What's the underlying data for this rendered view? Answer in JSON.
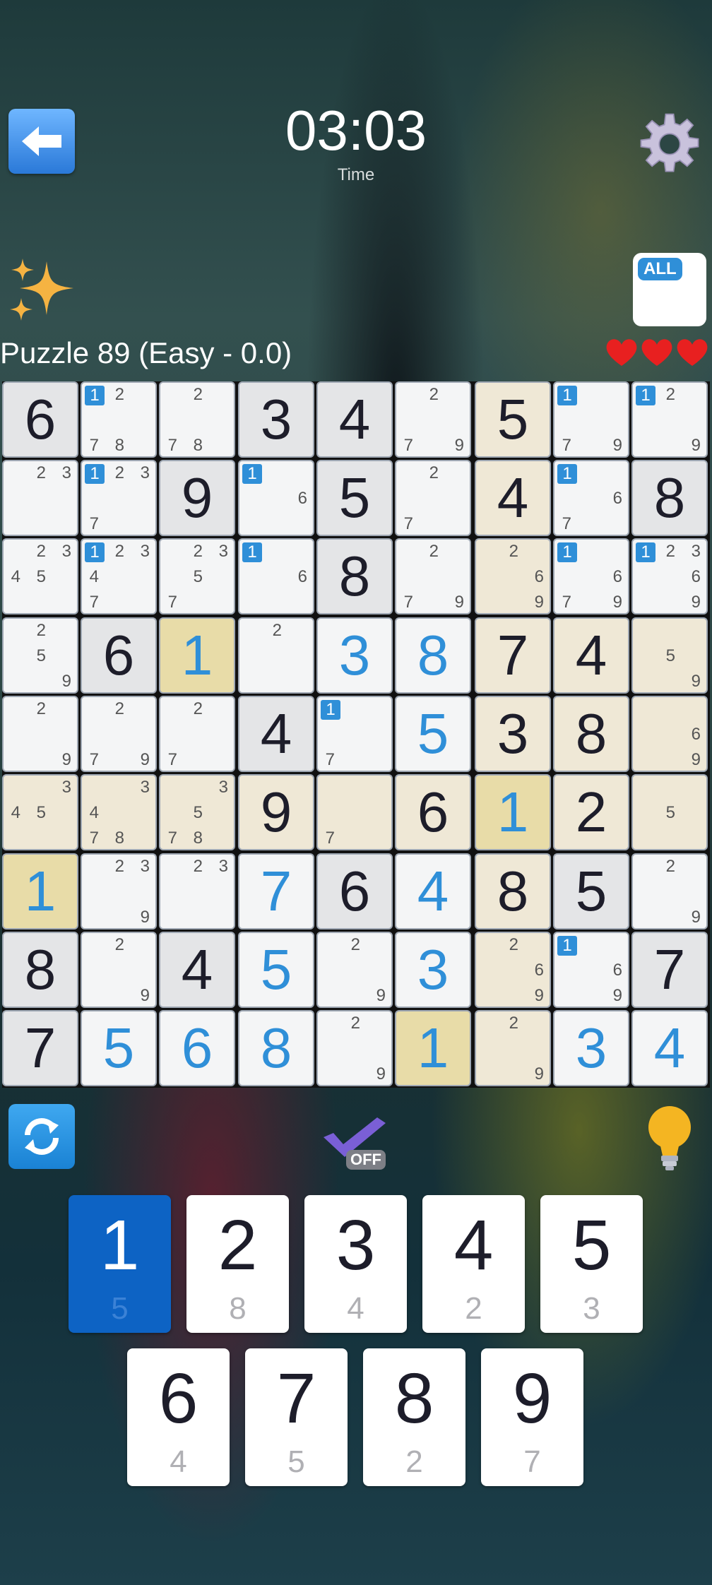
{
  "header": {
    "timer": "03:03",
    "timer_label": "Time"
  },
  "puzzle": {
    "title": "Puzzle 89 (Easy - 0.0)",
    "lives": 3
  },
  "all_button": {
    "badge": "ALL"
  },
  "auto_check": {
    "state_label": "OFF"
  },
  "colors": {
    "accent": "#2f8fd8",
    "selected_key": "#0d63c4",
    "given_text": "#1d1d2a",
    "user_text": "#2f8fd8",
    "heart": "#e82020"
  },
  "board": [
    [
      {
        "v": 6,
        "g": true,
        "c": "given"
      },
      {
        "n": [
          1,
          2,
          7,
          8
        ],
        "h": [
          1
        ],
        "c": "white"
      },
      {
        "n": [
          2,
          7,
          8
        ],
        "c": "white"
      },
      {
        "v": 3,
        "g": true,
        "c": "given"
      },
      {
        "v": 4,
        "g": true,
        "c": "given"
      },
      {
        "n": [
          2,
          7,
          9
        ],
        "c": "white"
      },
      {
        "v": 5,
        "g": true,
        "c": "peach"
      },
      {
        "n": [
          1,
          7,
          9
        ],
        "h": [
          1
        ],
        "c": "white"
      },
      {
        "n": [
          1,
          2,
          9
        ],
        "h": [
          1
        ],
        "c": "white"
      }
    ],
    [
      {
        "n": [
          2,
          3
        ],
        "c": "white"
      },
      {
        "n": [
          1,
          2,
          3,
          7
        ],
        "h": [
          1
        ],
        "c": "white"
      },
      {
        "v": 9,
        "g": true,
        "c": "given"
      },
      {
        "n": [
          1,
          6
        ],
        "h": [
          1
        ],
        "c": "white"
      },
      {
        "v": 5,
        "g": true,
        "c": "given"
      },
      {
        "n": [
          2,
          7
        ],
        "c": "white"
      },
      {
        "v": 4,
        "g": true,
        "c": "peach"
      },
      {
        "n": [
          1,
          6,
          7
        ],
        "h": [
          1
        ],
        "c": "white"
      },
      {
        "v": 8,
        "g": true,
        "c": "given"
      }
    ],
    [
      {
        "n": [
          2,
          3,
          4,
          5
        ],
        "c": "white"
      },
      {
        "n": [
          1,
          2,
          3,
          4,
          7
        ],
        "h": [
          1
        ],
        "c": "white"
      },
      {
        "n": [
          2,
          3,
          5,
          7
        ],
        "c": "white"
      },
      {
        "n": [
          1,
          6
        ],
        "h": [
          1
        ],
        "c": "white"
      },
      {
        "v": 8,
        "g": true,
        "c": "given"
      },
      {
        "n": [
          2,
          7,
          9
        ],
        "c": "white"
      },
      {
        "n": [
          2,
          6,
          9
        ],
        "c": "peach"
      },
      {
        "n": [
          1,
          6,
          7,
          9
        ],
        "h": [
          1
        ],
        "c": "white"
      },
      {
        "n": [
          1,
          2,
          3,
          6,
          9
        ],
        "h": [
          1
        ],
        "c": "white"
      }
    ],
    [
      {
        "n": [
          2,
          5,
          9
        ],
        "c": "white"
      },
      {
        "v": 6,
        "g": true,
        "c": "given"
      },
      {
        "v": 1,
        "g": false,
        "c": "sel"
      },
      {
        "n": [
          2
        ],
        "c": "white"
      },
      {
        "v": 3,
        "g": false,
        "c": "white"
      },
      {
        "v": 8,
        "g": false,
        "c": "white"
      },
      {
        "v": 7,
        "g": true,
        "c": "peach"
      },
      {
        "v": 4,
        "g": true,
        "c": "peach"
      },
      {
        "n": [
          5,
          9
        ],
        "c": "peach"
      }
    ],
    [
      {
        "n": [
          2,
          9
        ],
        "c": "white"
      },
      {
        "n": [
          2,
          7,
          9
        ],
        "c": "white"
      },
      {
        "n": [
          2,
          7
        ],
        "c": "white"
      },
      {
        "v": 4,
        "g": true,
        "c": "given"
      },
      {
        "n": [
          1,
          7
        ],
        "h": [
          1
        ],
        "c": "white"
      },
      {
        "v": 5,
        "g": false,
        "c": "white"
      },
      {
        "v": 3,
        "g": true,
        "c": "peach"
      },
      {
        "v": 8,
        "g": true,
        "c": "peach"
      },
      {
        "n": [
          6,
          9
        ],
        "c": "peach"
      }
    ],
    [
      {
        "n": [
          3,
          4,
          5
        ],
        "c": "peach"
      },
      {
        "n": [
          3,
          4,
          7,
          8
        ],
        "c": "peach"
      },
      {
        "n": [
          3,
          5,
          7,
          8
        ],
        "c": "peach"
      },
      {
        "v": 9,
        "g": true,
        "c": "peach"
      },
      {
        "n": [
          7
        ],
        "c": "peach"
      },
      {
        "v": 6,
        "g": true,
        "c": "peach"
      },
      {
        "v": 1,
        "g": false,
        "c": "sel"
      },
      {
        "v": 2,
        "g": true,
        "c": "peach"
      },
      {
        "n": [
          5
        ],
        "c": "peach"
      }
    ],
    [
      {
        "v": 1,
        "g": false,
        "c": "sel"
      },
      {
        "n": [
          2,
          3,
          9
        ],
        "c": "white"
      },
      {
        "n": [
          2,
          3
        ],
        "c": "white"
      },
      {
        "v": 7,
        "g": false,
        "c": "white"
      },
      {
        "v": 6,
        "g": true,
        "c": "given"
      },
      {
        "v": 4,
        "g": false,
        "c": "white"
      },
      {
        "v": 8,
        "g": true,
        "c": "peach"
      },
      {
        "v": 5,
        "g": true,
        "c": "given"
      },
      {
        "n": [
          2,
          9
        ],
        "c": "white"
      }
    ],
    [
      {
        "v": 8,
        "g": true,
        "c": "given"
      },
      {
        "n": [
          2,
          9
        ],
        "c": "white"
      },
      {
        "v": 4,
        "g": true,
        "c": "given"
      },
      {
        "v": 5,
        "g": false,
        "c": "white"
      },
      {
        "n": [
          2,
          9
        ],
        "c": "white"
      },
      {
        "v": 3,
        "g": false,
        "c": "white"
      },
      {
        "n": [
          2,
          6,
          9
        ],
        "c": "peach"
      },
      {
        "n": [
          1,
          6,
          9
        ],
        "h": [
          1
        ],
        "c": "white"
      },
      {
        "v": 7,
        "g": true,
        "c": "given"
      }
    ],
    [
      {
        "v": 7,
        "g": true,
        "c": "given"
      },
      {
        "v": 5,
        "g": false,
        "c": "white"
      },
      {
        "v": 6,
        "g": false,
        "c": "white"
      },
      {
        "v": 8,
        "g": false,
        "c": "white"
      },
      {
        "n": [
          2,
          9
        ],
        "c": "white"
      },
      {
        "v": 1,
        "g": false,
        "c": "sel"
      },
      {
        "n": [
          2,
          9
        ],
        "c": "peach"
      },
      {
        "v": 3,
        "g": false,
        "c": "white"
      },
      {
        "v": 4,
        "g": false,
        "c": "white"
      }
    ]
  ],
  "numpad": [
    {
      "digit": "1",
      "count": "5",
      "active": true
    },
    {
      "digit": "2",
      "count": "8",
      "active": false
    },
    {
      "digit": "3",
      "count": "4",
      "active": false
    },
    {
      "digit": "4",
      "count": "2",
      "active": false
    },
    {
      "digit": "5",
      "count": "3",
      "active": false
    },
    {
      "digit": "6",
      "count": "4",
      "active": false
    },
    {
      "digit": "7",
      "count": "5",
      "active": false
    },
    {
      "digit": "8",
      "count": "2",
      "active": false
    },
    {
      "digit": "9",
      "count": "7",
      "active": false
    }
  ]
}
